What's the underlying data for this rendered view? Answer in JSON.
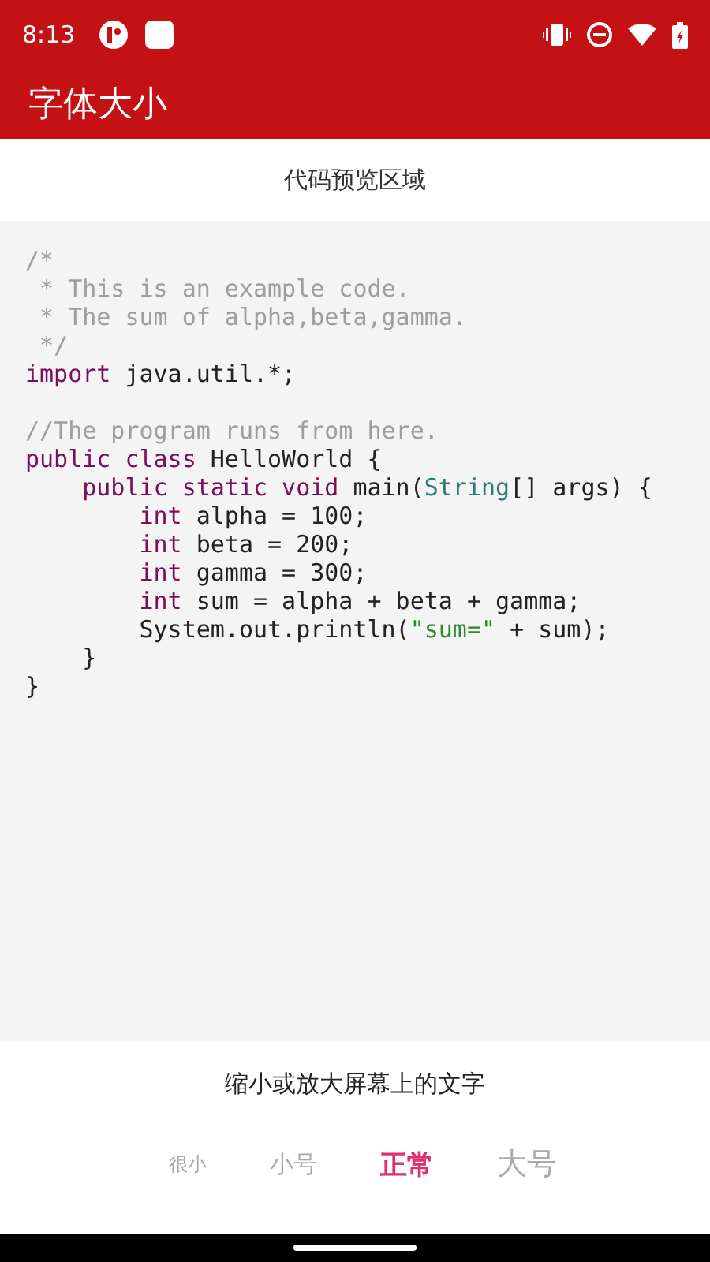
{
  "status_bar": {
    "time": "8:13"
  },
  "app_bar": {
    "title": "字体大小"
  },
  "preview": {
    "title": "代码预览区域",
    "lines": [
      {
        "kind": "code",
        "tokens": [
          {
            "kind": "comment",
            "text": "/*"
          }
        ]
      },
      {
        "kind": "code",
        "tokens": [
          {
            "kind": "comment",
            "text": " * This is an example code."
          }
        ]
      },
      {
        "kind": "code",
        "tokens": [
          {
            "kind": "comment",
            "text": " * The sum of alpha,beta,gamma."
          }
        ]
      },
      {
        "kind": "code",
        "tokens": [
          {
            "kind": "comment",
            "text": " */"
          }
        ]
      },
      {
        "kind": "code",
        "tokens": [
          {
            "kind": "keyword",
            "text": "import"
          },
          {
            "kind": "plain",
            "text": " java.util.*;"
          }
        ]
      },
      {
        "kind": "blank"
      },
      {
        "kind": "code",
        "tokens": [
          {
            "kind": "comment",
            "text": "//The program runs from here."
          }
        ]
      },
      {
        "kind": "code",
        "tokens": [
          {
            "kind": "keyword",
            "text": "public class"
          },
          {
            "kind": "plain",
            "text": " HelloWorld {"
          }
        ]
      },
      {
        "kind": "code",
        "tokens": [
          {
            "kind": "keyword",
            "text": "    public static void"
          },
          {
            "kind": "plain",
            "text": " main("
          },
          {
            "kind": "type",
            "text": "String"
          },
          {
            "kind": "plain",
            "text": "[] args) {"
          }
        ]
      },
      {
        "kind": "code",
        "tokens": [
          {
            "kind": "keyword",
            "text": "        int"
          },
          {
            "kind": "plain",
            "text": " alpha = 100;"
          }
        ]
      },
      {
        "kind": "code",
        "tokens": [
          {
            "kind": "keyword",
            "text": "        int"
          },
          {
            "kind": "plain",
            "text": " beta = 200;"
          }
        ]
      },
      {
        "kind": "code",
        "tokens": [
          {
            "kind": "keyword",
            "text": "        int"
          },
          {
            "kind": "plain",
            "text": " gamma = 300;"
          }
        ]
      },
      {
        "kind": "code",
        "tokens": [
          {
            "kind": "keyword",
            "text": "        int"
          },
          {
            "kind": "plain",
            "text": " sum = alpha + beta + gamma;"
          }
        ]
      },
      {
        "kind": "code",
        "tokens": [
          {
            "kind": "plain",
            "text": "        System.out.println("
          },
          {
            "kind": "string",
            "text": "\"sum=\""
          },
          {
            "kind": "plain",
            "text": " + sum);"
          }
        ]
      },
      {
        "kind": "code",
        "tokens": [
          {
            "kind": "plain",
            "text": "    }"
          }
        ]
      },
      {
        "kind": "code",
        "tokens": [
          {
            "kind": "plain",
            "text": "}"
          }
        ]
      }
    ]
  },
  "size_picker": {
    "caption": "缩小或放大屏幕上的文字",
    "options": [
      {
        "label": "很小",
        "selected": false
      },
      {
        "label": "小号",
        "selected": false
      },
      {
        "label": "正常",
        "selected": true
      },
      {
        "label": "大号",
        "selected": false
      }
    ]
  }
}
